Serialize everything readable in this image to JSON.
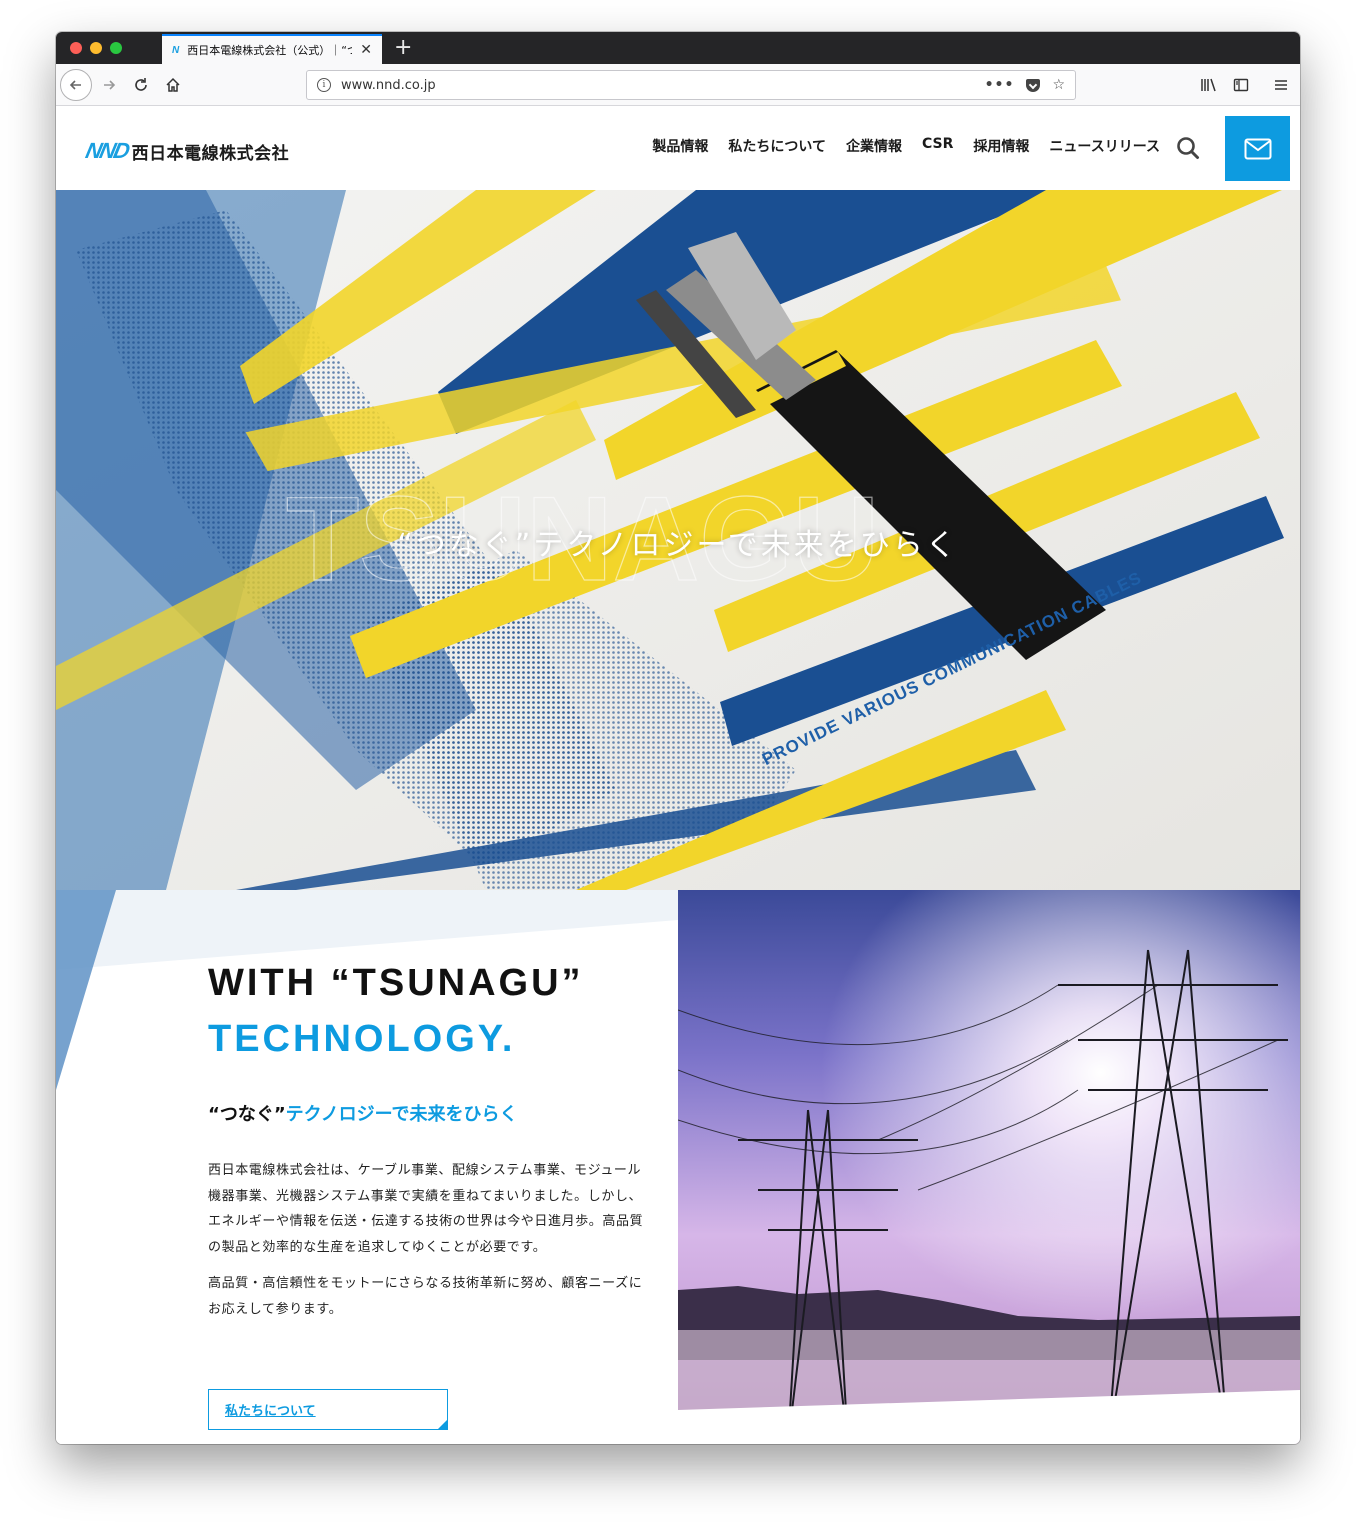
{
  "browser": {
    "tab_title": "西日本電線株式会社（公式）｜“つ",
    "tab_favicon": "N",
    "tab_close": "✕",
    "new_tab": "+",
    "url": "www.nnd.co.jp",
    "icons": {
      "back": "back-arrow-icon",
      "forward": "forward-arrow-icon",
      "reload": "reload-icon",
      "home": "home-icon",
      "page_actions": "more-dots-icon",
      "pocket": "pocket-icon",
      "bookmark": "star-icon",
      "library": "library-icon",
      "sidebar": "sidebar-icon",
      "menu": "hamburger-menu-icon"
    }
  },
  "site": {
    "logo_mark": "NND",
    "logo_text": "西日本電線株式会社",
    "nav": [
      "製品情報",
      "私たちについて",
      "企業情報",
      "CSR",
      "採用情報",
      "ニュースリリース"
    ],
    "search_icon": "search-icon",
    "mail_icon": "mail-icon",
    "accent_color": "#0d9be0"
  },
  "hero": {
    "catch": "“つなぐ”テクノロジーで未来をひらく",
    "sub": "PROVIDE VARIOUS COMMUNICATION CABLES",
    "colors": {
      "yellow": "#f2d52a",
      "blue": "#1a4f92"
    }
  },
  "intro": {
    "heading_line1": "WITH “TSUNAGU”",
    "heading_line2": "TECHNOLOGY.",
    "subheading_dark": "“つなぐ”",
    "subheading_blue": "テクノロジーで未来をひらく",
    "paragraph1": "西日本電線株式会社は、ケーブル事業、配線システム事業、モジュール機器事業、光機器システム事業で実績を重ねてまいりました。しかし、エネルギーや情報を伝送・伝達する技術の世界は今や日進月歩。高品質の製品と効率的な生産を追求してゆくことが必要です。",
    "paragraph2": "高品質・高信頼性をモットーにさらなる技術革新に努め、顧客ニーズにお応えして参ります。",
    "button_label": "私たちについて"
  }
}
